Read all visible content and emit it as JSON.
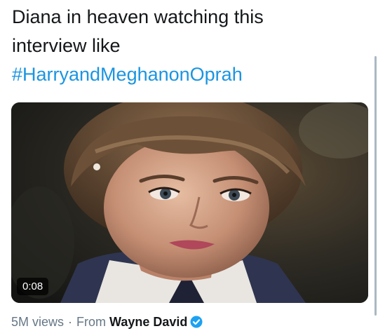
{
  "tweet": {
    "text_line1": "Diana in heaven watching this",
    "text_line2": "interview like",
    "hashtag": "#HarryandMeghanonOprah"
  },
  "media": {
    "duration": "0:08"
  },
  "meta": {
    "views": "5M views",
    "separator": "·",
    "from_label": "From",
    "author": "Wayne David",
    "verified_icon": "verified-badge-icon"
  },
  "colors": {
    "hashtag": "#1b95e0",
    "text": "#14171a",
    "muted": "#657786",
    "verified": "#1da1f2"
  }
}
